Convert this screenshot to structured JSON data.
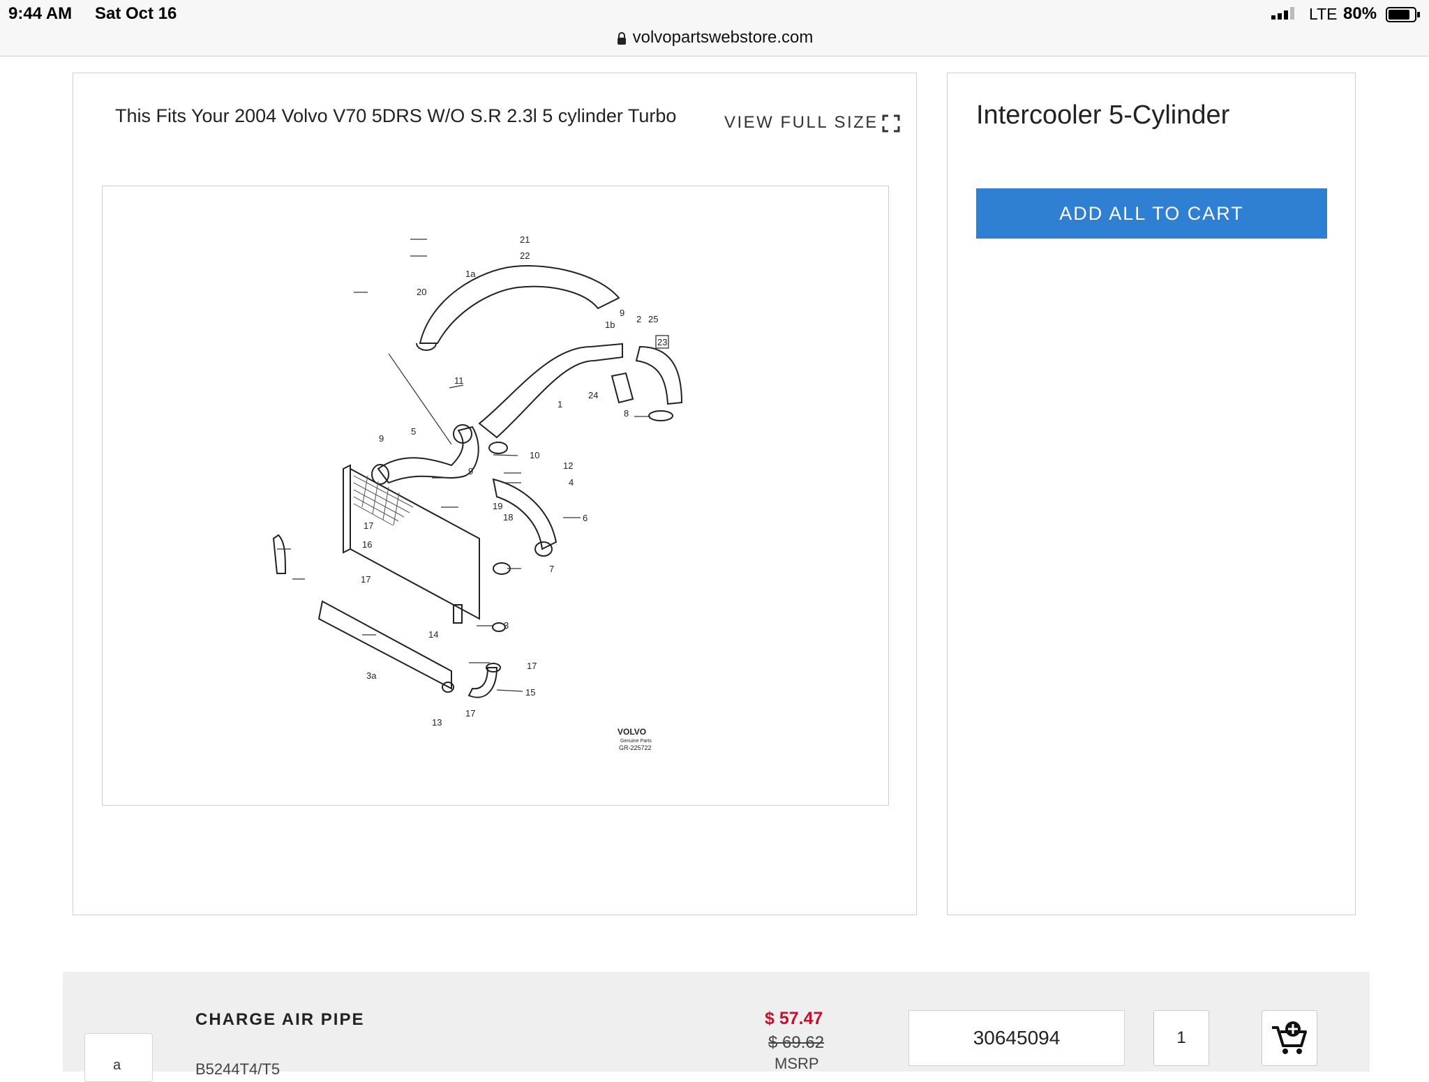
{
  "status_bar": {
    "time": "9:44 AM",
    "date": "Sat Oct 16",
    "url": "volvopartswebstore.com",
    "network": "LTE",
    "battery": "80%"
  },
  "fitment": {
    "text": "This Fits Your 2004 Volvo V70 5DRS W/O S.R 2.3l 5 cylinder Turbo",
    "view_full_size": "VIEW FULL SIZE"
  },
  "diagram": {
    "callouts": [
      "21",
      "22",
      "1a",
      "20",
      "9",
      "1b",
      "2",
      "25",
      "23",
      "24",
      "8",
      "11",
      "1",
      "5",
      "9",
      "9",
      "10",
      "12",
      "4",
      "19",
      "18",
      "6",
      "17",
      "16",
      "17",
      "7",
      "3",
      "14",
      "17",
      "3a",
      "15",
      "13",
      "17"
    ],
    "brand": "VOLVO",
    "brand_sub": "Genuine Parts",
    "ref": "GR-225722"
  },
  "group": {
    "title": "Intercooler 5-Cylinder",
    "add_all_label": "ADD ALL TO CART"
  },
  "part": {
    "thumb_label": "a",
    "name": "CHARGE AIR PIPE",
    "subtitle": "B5244T4/T5",
    "price": "$ 57.47",
    "msrp_price": "$ 69.62",
    "msrp_label": "MSRP",
    "part_number": "30645094",
    "quantity": "1"
  }
}
